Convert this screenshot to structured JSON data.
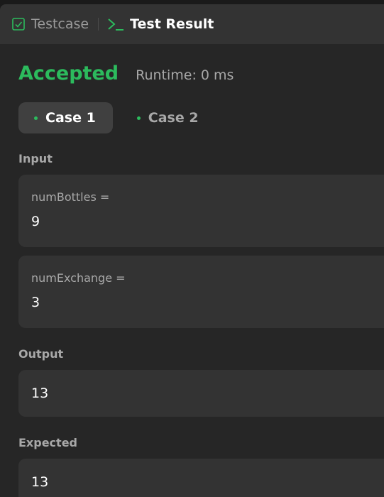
{
  "tabs": [
    {
      "label": "Testcase",
      "icon": "checkbox-icon",
      "active": false
    },
    {
      "label": "Test Result",
      "icon": "terminal-icon",
      "active": true
    }
  ],
  "result": {
    "status": "Accepted",
    "runtime": "Runtime: 0 ms"
  },
  "cases": [
    {
      "label": "Case 1",
      "active": true
    },
    {
      "label": "Case 2",
      "active": false
    }
  ],
  "input": {
    "label": "Input",
    "params": [
      {
        "name": "numBottles =",
        "value": "9"
      },
      {
        "name": "numExchange =",
        "value": "3"
      }
    ]
  },
  "output": {
    "label": "Output",
    "value": "13"
  },
  "expected": {
    "label": "Expected",
    "value": "13"
  },
  "colors": {
    "accent": "#2cbb5d",
    "panel": "#262626",
    "box": "#333333"
  }
}
